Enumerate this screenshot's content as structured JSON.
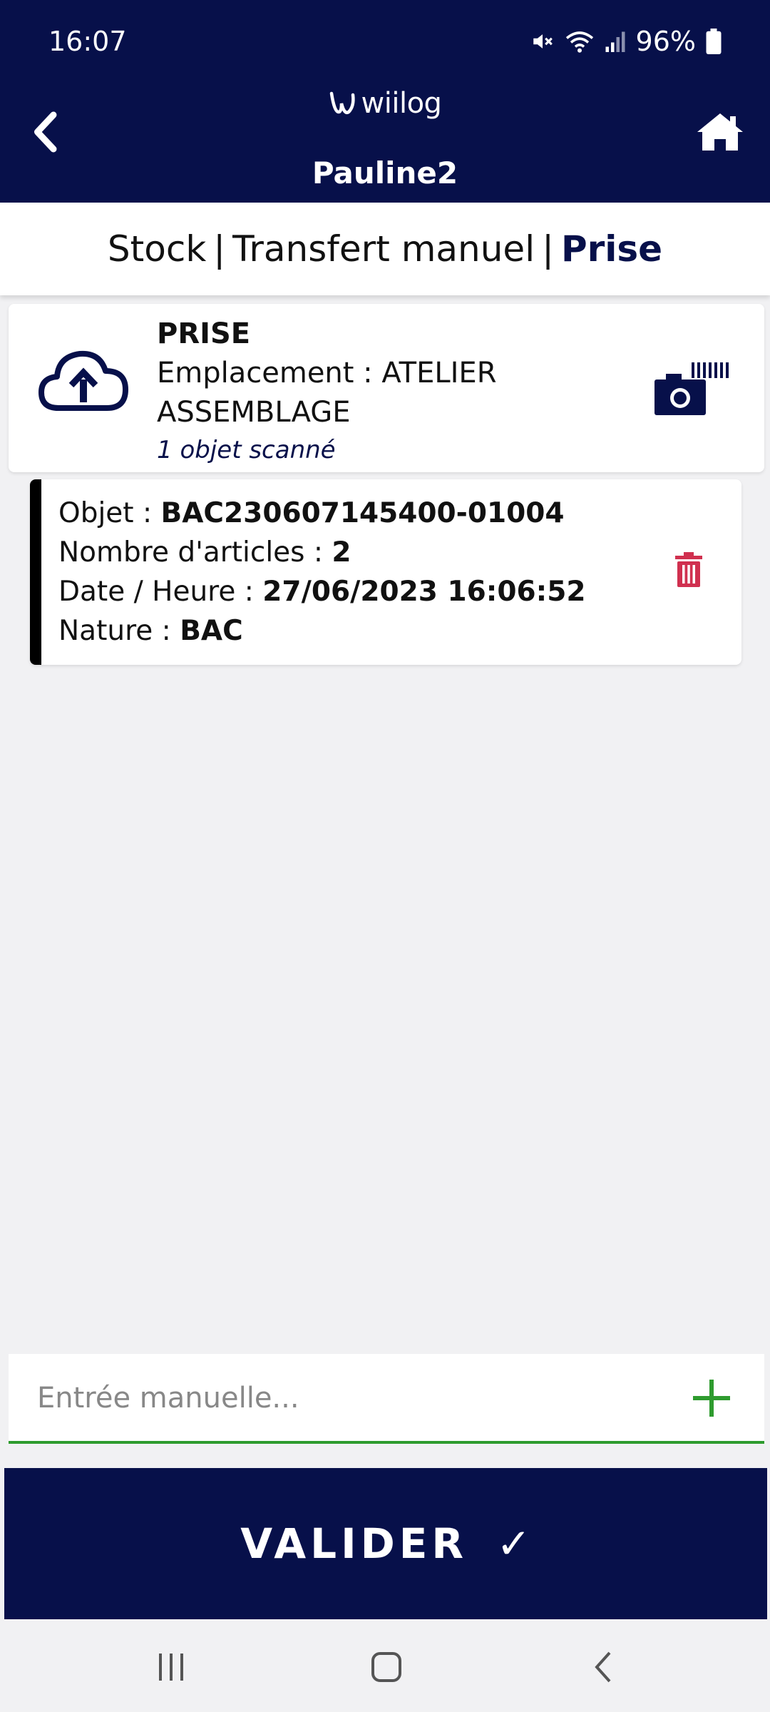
{
  "status": {
    "time": "16:07",
    "battery": "96%"
  },
  "header": {
    "logo_text": "wiilog",
    "user": "Pauline2"
  },
  "breadcrumb": {
    "items": [
      "Stock",
      "Transfert manuel"
    ],
    "active": "Prise",
    "separator": "|"
  },
  "prise": {
    "title": "PRISE",
    "location_line1": "Emplacement : ATELIER",
    "location_line2": "ASSEMBLAGE",
    "count": "1 objet scanné"
  },
  "object": {
    "objet_label": "Objet : ",
    "objet_value": "BAC230607145400-01004",
    "articles_label": "Nombre d'articles : ",
    "articles_value": "2",
    "date_label": "Date / Heure : ",
    "date_value": "27/06/2023 16:06:52",
    "nature_label": "Nature : ",
    "nature_value": "BAC"
  },
  "manual_entry": {
    "placeholder": "Entrée manuelle..."
  },
  "valider": {
    "label": "VALIDER",
    "check": "✓"
  },
  "colors": {
    "primary": "#07104a",
    "accent_green": "#2e9b2e",
    "danger": "#d0304f",
    "background": "#f1f1f3"
  },
  "icons": [
    "back-arrow-icon",
    "home-icon",
    "cloud-upload-icon",
    "camera-barcode-icon",
    "trash-icon",
    "plus-icon",
    "mute-icon",
    "wifi-icon",
    "signal-icon",
    "battery-icon",
    "recent-apps-icon",
    "home-nav-icon",
    "back-nav-icon"
  ]
}
